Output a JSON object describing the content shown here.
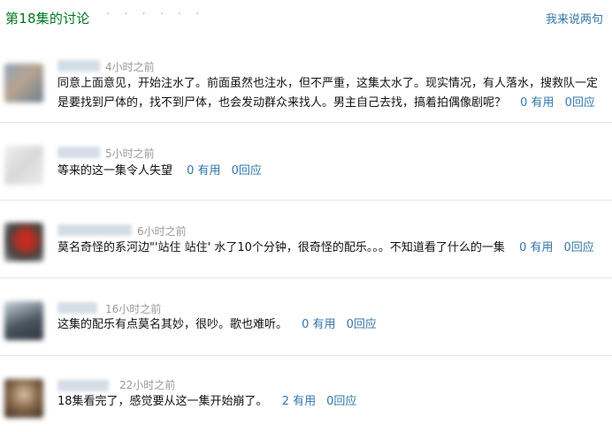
{
  "header": {
    "title": "第18集的讨论",
    "dots": "· · · · · ·",
    "link": "我来说两句"
  },
  "comments": [
    {
      "time": "4小时之前",
      "text_line1": "同意上面意见，开始注水了。前面虽然也注水，但不严重，这集太水了。现实情况，有人落水，搜救队一定",
      "text_line2": "是要找到尸体的，找不到尸体，也会发动群众来找人。男主自己去找，搞着拍偶像剧呢？",
      "useful": "0 有用",
      "reply": "0回应"
    },
    {
      "time": "5小时之前",
      "text": "等来的这一集令人失望",
      "useful": "0 有用",
      "reply": "0回应"
    },
    {
      "time": "6小时之前",
      "text": "莫名奇怪的系河边\"'站住 站住' 水了10个分钟，很奇怪的配乐。。。不知道看了什么的一集",
      "useful": "0 有用",
      "reply": "0回应"
    },
    {
      "time": "16小时之前",
      "text": "这集的配乐有点莫名其妙，很吵。歌也难听。",
      "useful": "0 有用",
      "reply": "0回应"
    },
    {
      "time": "22小时之前",
      "text": "18集看完了，感觉要从这一集开始崩了。",
      "useful": "2 有用",
      "reply": "0回应"
    }
  ]
}
